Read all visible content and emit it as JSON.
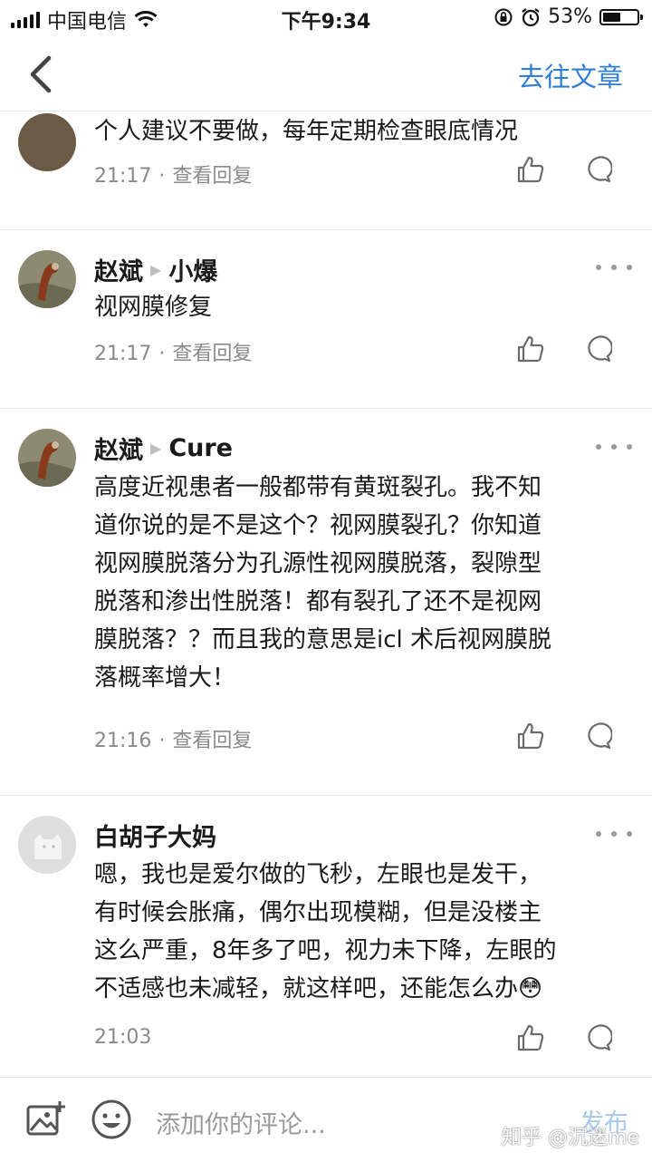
{
  "status_bar": {
    "carrier": "中国电信",
    "time": "下午9:34",
    "battery": "53%",
    "battery_level": 0.53
  },
  "nav": {
    "back_icon": "chevron-left-icon",
    "goto_article": "去往文章"
  },
  "comments": [
    {
      "author": "",
      "reply_to": "",
      "lines": [
        "个人建议不要做，每年定期检查眼底情况"
      ],
      "time": "21:17",
      "view_replies": "查看回复"
    },
    {
      "author": "赵斌",
      "reply_to": "小爆",
      "lines": [
        "视网膜修复"
      ],
      "time": "21:17",
      "view_replies": "查看回复"
    },
    {
      "author": "赵斌",
      "reply_to": "Cure",
      "lines": [
        "高度近视患者一般都带有黄斑裂孔。我不知",
        "道你说的是不是这个？视网膜裂孔？你知道",
        "视网膜脱落分为孔源性视网膜脱落，裂隙型",
        "脱落和渗出性脱落！都有裂孔了还不是视网",
        "膜脱落？？而且我的意思是icl 术后视网膜脱",
        "落概率增大！"
      ],
      "time": "21:16",
      "view_replies": "查看回复"
    },
    {
      "author": "白胡子大妈",
      "reply_to": "",
      "lines": [
        "嗯，我也是爱尔做的飞秒，左眼也是发干，",
        "有时候会胀痛，偶尔出现模糊，但是没楼主",
        "这么严重，8年多了吧，视力未下降，左眼的",
        "不适感也未减轻，就这样吧，还能怎么办😳"
      ],
      "time": "21:03",
      "view_replies": ""
    }
  ],
  "bottom_bar": {
    "image_icon": "image-add-icon",
    "emoji_icon": "emoji-icon",
    "placeholder": "添加你的评论...",
    "publish": "发布",
    "watermark": "知乎 @沉迷me"
  },
  "colors": {
    "accent": "#2f7fd6",
    "publish_disabled": "#a8c8ee",
    "meta_text": "#8a8a8a",
    "divider": "#e6e6e6"
  }
}
